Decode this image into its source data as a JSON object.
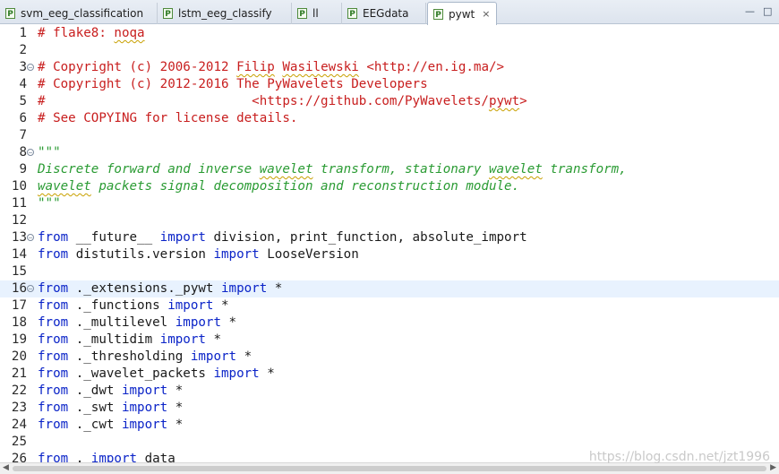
{
  "tabs": [
    {
      "label": "svm_eeg_classification",
      "icon": "python-file-icon"
    },
    {
      "label": "lstm_eeg_classify",
      "icon": "python-file-icon"
    },
    {
      "label": "ll",
      "icon": "python-file-icon"
    },
    {
      "label": "EEGdata",
      "icon": "python-file-icon"
    },
    {
      "label": "pywt",
      "icon": "python-file-icon",
      "active": true,
      "close": "×"
    }
  ],
  "window_controls": {
    "minimize": "—",
    "maximize": "□"
  },
  "lines": [
    {
      "n": "1",
      "seg": [
        [
          "c-com",
          "# flake8: "
        ],
        [
          "c-com squig",
          "noqa"
        ]
      ]
    },
    {
      "n": "2",
      "seg": []
    },
    {
      "n": "3",
      "fold": "−",
      "seg": [
        [
          "c-com",
          "# Copyright (c) 2006-2012 "
        ],
        [
          "c-com squig",
          "Filip"
        ],
        [
          "c-com",
          " "
        ],
        [
          "c-com squig",
          "Wasilewski"
        ],
        [
          "c-com",
          " <http://en.ig.ma/>"
        ]
      ]
    },
    {
      "n": "4",
      "seg": [
        [
          "c-com",
          "# Copyright (c) 2012-2016 The PyWavelets Developers"
        ]
      ]
    },
    {
      "n": "5",
      "seg": [
        [
          "c-com",
          "#                           <https://github.com/PyWavelets/"
        ],
        [
          "c-com squig",
          "pywt"
        ],
        [
          "c-com",
          ">"
        ]
      ]
    },
    {
      "n": "6",
      "seg": [
        [
          "c-com",
          "# See COPYING for license details."
        ]
      ]
    },
    {
      "n": "7",
      "seg": []
    },
    {
      "n": "8",
      "fold": "−",
      "seg": [
        [
          "c-str",
          "\"\"\""
        ]
      ]
    },
    {
      "n": "9",
      "seg": [
        [
          "c-str",
          "Discrete forward and inverse "
        ],
        [
          "c-str squig",
          "wavelet"
        ],
        [
          "c-str",
          " transform, stationary "
        ],
        [
          "c-str squig",
          "wavelet"
        ],
        [
          "c-str",
          " transform,"
        ]
      ]
    },
    {
      "n": "10",
      "seg": [
        [
          "c-str squig",
          "wavelet"
        ],
        [
          "c-str",
          " packets signal decomposition and reconstruction module."
        ]
      ]
    },
    {
      "n": "11",
      "seg": [
        [
          "c-str",
          "\"\"\""
        ]
      ]
    },
    {
      "n": "12",
      "seg": []
    },
    {
      "n": "13",
      "fold": "−",
      "seg": [
        [
          "c-kw",
          "from"
        ],
        [
          "c-def",
          " __future__ "
        ],
        [
          "c-kw",
          "import"
        ],
        [
          "c-def",
          " division, print_function, absolute_import"
        ]
      ]
    },
    {
      "n": "14",
      "seg": [
        [
          "c-kw",
          "from"
        ],
        [
          "c-def",
          " distutils.version "
        ],
        [
          "c-kw",
          "import"
        ],
        [
          "c-def",
          " LooseVersion"
        ]
      ]
    },
    {
      "n": "15",
      "seg": []
    },
    {
      "n": "16",
      "fold": "−",
      "current": true,
      "seg": [
        [
          "c-kw",
          "from"
        ],
        [
          "c-def",
          " ._extensions._pywt "
        ],
        [
          "c-kw",
          "import"
        ],
        [
          "c-def",
          " *"
        ]
      ]
    },
    {
      "n": "17",
      "seg": [
        [
          "c-kw",
          "from"
        ],
        [
          "c-def",
          " ._functions "
        ],
        [
          "c-kw",
          "import"
        ],
        [
          "c-def",
          " *"
        ]
      ]
    },
    {
      "n": "18",
      "seg": [
        [
          "c-kw",
          "from"
        ],
        [
          "c-def",
          " ._multilevel "
        ],
        [
          "c-kw",
          "import"
        ],
        [
          "c-def",
          " *"
        ]
      ]
    },
    {
      "n": "19",
      "seg": [
        [
          "c-kw",
          "from"
        ],
        [
          "c-def",
          " ._multidim "
        ],
        [
          "c-kw",
          "import"
        ],
        [
          "c-def",
          " *"
        ]
      ]
    },
    {
      "n": "20",
      "seg": [
        [
          "c-kw",
          "from"
        ],
        [
          "c-def",
          " ._thresholding "
        ],
        [
          "c-kw",
          "import"
        ],
        [
          "c-def",
          " *"
        ]
      ]
    },
    {
      "n": "21",
      "seg": [
        [
          "c-kw",
          "from"
        ],
        [
          "c-def",
          " ._wavelet_packets "
        ],
        [
          "c-kw",
          "import"
        ],
        [
          "c-def",
          " *"
        ]
      ]
    },
    {
      "n": "22",
      "seg": [
        [
          "c-kw",
          "from"
        ],
        [
          "c-def",
          " ._dwt "
        ],
        [
          "c-kw",
          "import"
        ],
        [
          "c-def",
          " *"
        ]
      ]
    },
    {
      "n": "23",
      "seg": [
        [
          "c-kw",
          "from"
        ],
        [
          "c-def",
          " ._swt "
        ],
        [
          "c-kw",
          "import"
        ],
        [
          "c-def",
          " *"
        ]
      ]
    },
    {
      "n": "24",
      "seg": [
        [
          "c-kw",
          "from"
        ],
        [
          "c-def",
          " ._cwt "
        ],
        [
          "c-kw",
          "import"
        ],
        [
          "c-def",
          " *"
        ]
      ]
    },
    {
      "n": "25",
      "seg": []
    },
    {
      "n": "26",
      "seg": [
        [
          "c-kw",
          "from"
        ],
        [
          "c-def",
          " . "
        ],
        [
          "c-kw",
          "import"
        ],
        [
          "c-def",
          " data"
        ]
      ]
    }
  ],
  "watermark": "https://blog.csdn.net/jzt1996",
  "colors": {
    "comment": "#c81e1e",
    "docstring": "#2a9b33",
    "keyword": "#0b24c8",
    "current_line": "#e8f2fe"
  }
}
